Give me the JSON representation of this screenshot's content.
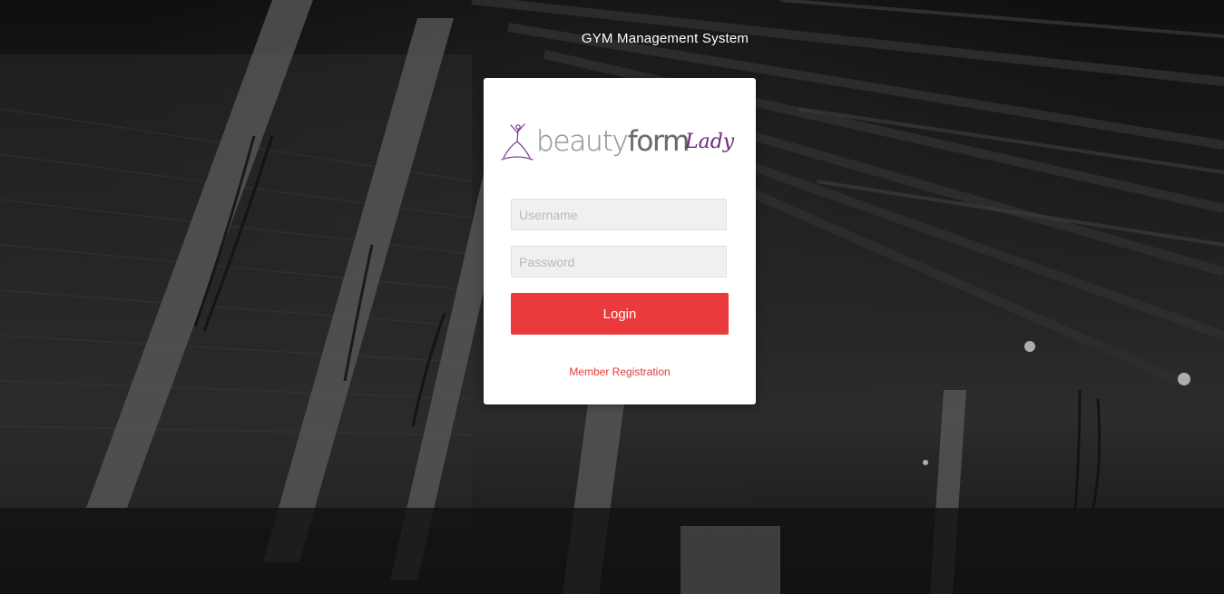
{
  "app": {
    "title": "GYM Management System"
  },
  "brand": {
    "word_light": "beauty",
    "word_bold": "form",
    "script": "Lady",
    "accent_color": "#6b2a78"
  },
  "login_form": {
    "username_placeholder": "Username",
    "password_placeholder": "Password",
    "login_label": "Login",
    "register_link": "Member Registration",
    "button_color": "#ea3a3b"
  }
}
